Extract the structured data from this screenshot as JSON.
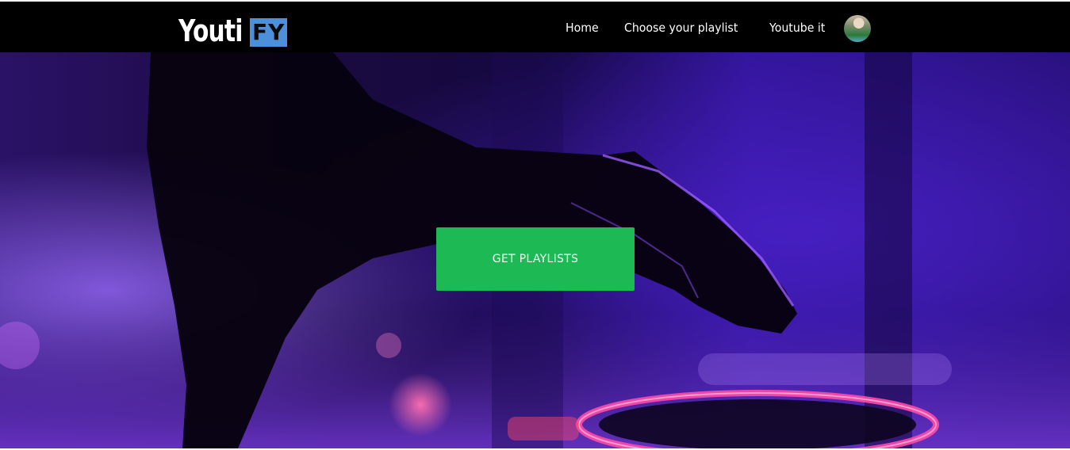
{
  "header": {
    "logo": {
      "part_a": "Youti",
      "part_b": "FY"
    },
    "nav": [
      {
        "label": "Home"
      },
      {
        "label": "Choose your playlist"
      },
      {
        "label": "Youtube it"
      }
    ],
    "avatar_icon": "user-avatar"
  },
  "hero": {
    "button_label": "GET PLAYLISTS",
    "background_image": "dj-hand-over-turntable-purple-light"
  },
  "colors": {
    "navbar_bg": "#000000",
    "logo_accent": "#4d8fdb",
    "cta_green": "#1db954",
    "hero_purple": "#3a17a8"
  }
}
